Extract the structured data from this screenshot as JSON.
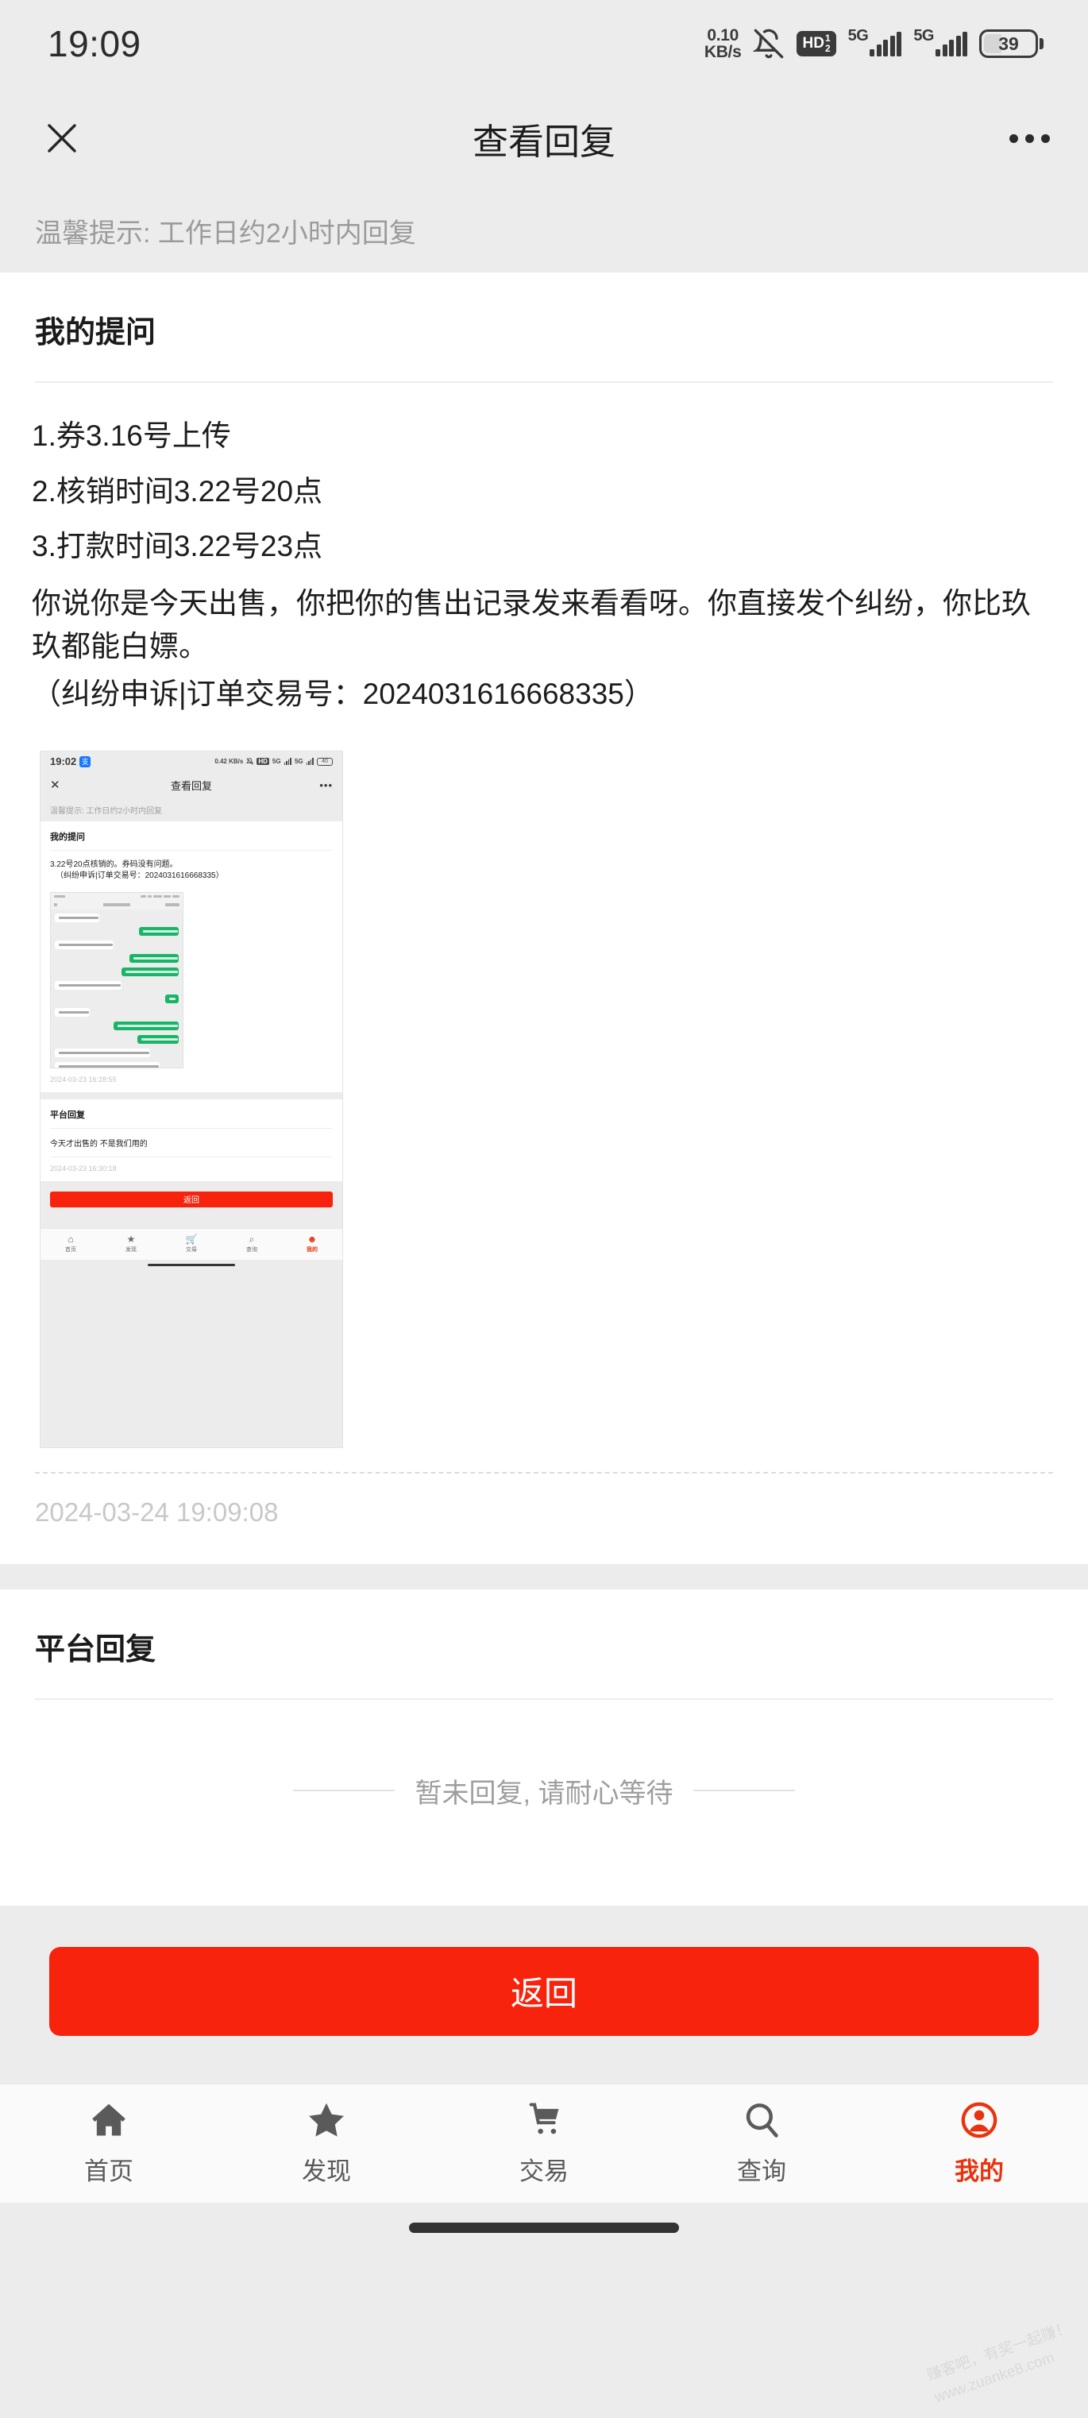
{
  "statusbar": {
    "time": "19:09",
    "net_speed_value": "0.10",
    "net_speed_unit": "KB/s",
    "mute_icon": "bell-muted-icon",
    "hd_label": "HD",
    "hd_sup": "1",
    "hd_sub": "2",
    "sim1_network": "5G",
    "sim2_network": "5G",
    "battery_percent": "39"
  },
  "navbar": {
    "close_icon": "close-icon",
    "title": "查看回复",
    "more_icon": "more-dots-icon"
  },
  "tip": {
    "text": "温馨提示: 工作日约2小时内回复"
  },
  "question": {
    "section_title": "我的提问",
    "lines": [
      "1.券3.16号上传",
      "2.核销时间3.22号20点",
      "3.打款时间3.22号23点"
    ],
    "paragraph": "你说你是今天出售，你把你的售出记录发来看看呀。你直接发个纠纷，你比玖玖都能白嫖。",
    "order_line": "（纠纷申诉|订单交易号：2024031616668335）",
    "timestamp": "2024-03-24 19:09:08",
    "attachment_alt": "聊天记录截图"
  },
  "attachment": {
    "statusbar": {
      "time": "19:02",
      "alipay_badge": "支",
      "net_speed": "0.42 KB/s",
      "hd_label": "HD",
      "sim1_network": "5G",
      "sim2_network": "5G",
      "battery_percent": "40"
    },
    "navbar": {
      "close_icon": "close-icon",
      "title": "查看回复",
      "more_icon": "more-dots-icon"
    },
    "tip": "温馨提示: 工作日约2小时内回复",
    "section_title": "我的提问",
    "question_line": "3.22号20点核销的。券码没有问题。",
    "order_line": "（纠纷申诉|订单交易号：2024031616668335）",
    "question_time": "2024-03-23 16:28:55",
    "reply_section_title": "平台回复",
    "reply_text": "今天才出售的 不是我们用的",
    "reply_time": "2024-03-23 16:30:18",
    "back_button": "返回",
    "tabs": [
      {
        "icon": "home-icon",
        "label": "首页",
        "active": false
      },
      {
        "icon": "star-icon",
        "label": "发现",
        "active": false
      },
      {
        "icon": "cart-icon",
        "label": "交易",
        "active": false
      },
      {
        "icon": "search-icon",
        "label": "查询",
        "active": false
      },
      {
        "icon": "user-icon",
        "label": "我的",
        "active": true
      }
    ]
  },
  "platform_reply": {
    "section_title": "平台回复",
    "empty_text": "暂未回复, 请耐心等待"
  },
  "actions": {
    "back_button": "返回"
  },
  "tabbar": {
    "items": [
      {
        "icon": "home-icon",
        "label": "首页",
        "active": false
      },
      {
        "icon": "star-icon",
        "label": "发现",
        "active": false
      },
      {
        "icon": "cart-icon",
        "label": "交易",
        "active": false
      },
      {
        "icon": "search-icon",
        "label": "查询",
        "active": false
      },
      {
        "icon": "user-icon",
        "label": "我的",
        "active": true
      }
    ]
  },
  "watermark": {
    "line1": "赚客吧，有奖一起赚！",
    "line2": "www.zuanke8.com"
  },
  "colors": {
    "accent_red": "#f7230c",
    "active_tab": "#e8330e",
    "page_bg": "#ececec",
    "card_bg": "#ffffff",
    "muted_text": "#9b9b9b",
    "chat_bubble_green": "#18b566"
  }
}
